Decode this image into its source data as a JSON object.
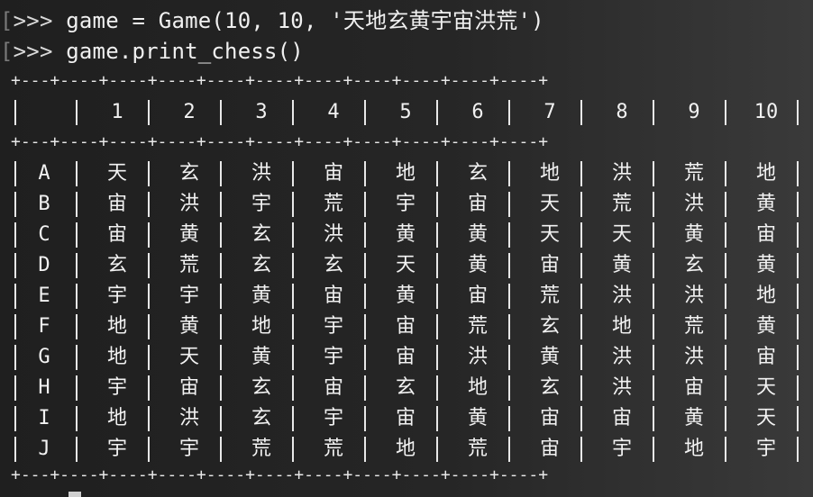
{
  "terminal": {
    "line1": {
      "bracket": "[",
      "prompt": ">>>",
      "command": " game = Game(10, 10, '天地玄黄宇宙洪荒')"
    },
    "line2": {
      "bracket": "[",
      "prompt": ">>>",
      "command": " game.print_chess()"
    }
  },
  "board": {
    "border_top": "+---+----+----+----+----+----+----+----+----+----+----+",
    "border_mid": "+---+----+----+----+----+----+----+----+----+----+----+",
    "border_bottom": "+---+----+----+----+----+----+----+----+----+----+----+",
    "corner_header": "",
    "columns": [
      "1",
      "2",
      "3",
      "4",
      "5",
      "6",
      "7",
      "8",
      "9",
      "10"
    ],
    "rows": [
      {
        "label": "A",
        "cells": [
          "天",
          "玄",
          "洪",
          "宙",
          "地",
          "玄",
          "地",
          "洪",
          "荒",
          "地"
        ]
      },
      {
        "label": "B",
        "cells": [
          "宙",
          "洪",
          "宇",
          "荒",
          "宇",
          "宙",
          "天",
          "荒",
          "洪",
          "黄"
        ]
      },
      {
        "label": "C",
        "cells": [
          "宙",
          "黄",
          "玄",
          "洪",
          "黄",
          "黄",
          "天",
          "天",
          "黄",
          "宙"
        ]
      },
      {
        "label": "D",
        "cells": [
          "玄",
          "荒",
          "玄",
          "玄",
          "天",
          "黄",
          "宙",
          "黄",
          "玄",
          "黄"
        ]
      },
      {
        "label": "E",
        "cells": [
          "宇",
          "宇",
          "黄",
          "宙",
          "黄",
          "宙",
          "荒",
          "洪",
          "洪",
          "地"
        ]
      },
      {
        "label": "F",
        "cells": [
          "地",
          "黄",
          "地",
          "宇",
          "宙",
          "荒",
          "玄",
          "地",
          "荒",
          "黄"
        ]
      },
      {
        "label": "G",
        "cells": [
          "地",
          "天",
          "黄",
          "宇",
          "宙",
          "洪",
          "黄",
          "洪",
          "洪",
          "宙"
        ]
      },
      {
        "label": "H",
        "cells": [
          "宇",
          "宙",
          "玄",
          "宙",
          "玄",
          "地",
          "玄",
          "洪",
          "宙",
          "天"
        ]
      },
      {
        "label": "I",
        "cells": [
          "地",
          "洪",
          "玄",
          "宇",
          "宙",
          "黄",
          "宙",
          "宙",
          "黄",
          "天"
        ]
      },
      {
        "label": "J",
        "cells": [
          "宇",
          "宇",
          "荒",
          "荒",
          "地",
          "荒",
          "宙",
          "宇",
          "地",
          "宇"
        ]
      }
    ]
  }
}
